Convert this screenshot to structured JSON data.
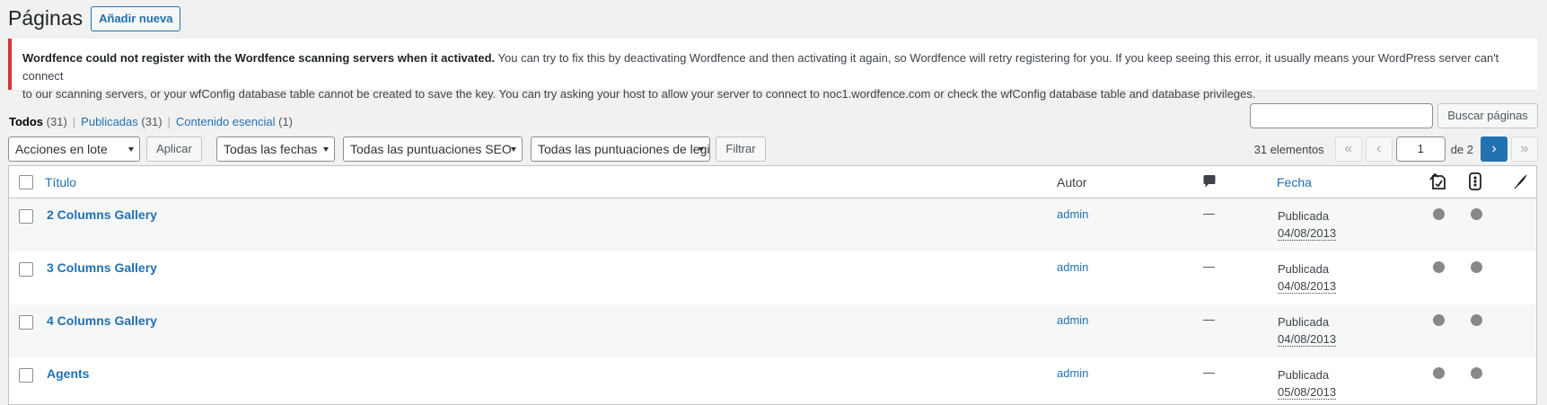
{
  "header": {
    "title": "Páginas",
    "add_new": "Añadir nueva"
  },
  "notice": {
    "bold": "Wordfence could not register with the Wordfence scanning servers when it activated.",
    "line1_rest": " You can try to fix this by deactivating Wordfence and then activating it again, so Wordfence will retry registering for you. If you keep seeing this error, it usually means your WordPress server can't connect",
    "line2": "to our scanning servers, or your wfConfig database table cannot be created to save the key. You can try asking your host to allow your server to connect to noc1.wordfence.com or check the wfConfig database table and database privileges."
  },
  "views": [
    {
      "label": "Todos",
      "count": "(31)"
    },
    {
      "label": "Publicadas",
      "count": "(31)"
    },
    {
      "label": "Contenido esencial",
      "count": "(1)"
    }
  ],
  "views_sep": "|",
  "search": {
    "value": "",
    "button": "Buscar páginas"
  },
  "tablenav": {
    "bulk_actions": "Acciones en lote",
    "apply": "Aplicar",
    "dates": "Todas las fechas",
    "seo_scores": "Todas las puntuaciones SEO",
    "readability_scores": "Todas las puntuaciones de legibilidad",
    "filter": "Filtrar"
  },
  "pagination": {
    "items": "31 elementos",
    "first": "«",
    "prev": "‹",
    "current": "1",
    "of_total": "de 2",
    "next": "›",
    "last": "»"
  },
  "columns": {
    "title": "Título",
    "author": "Autor",
    "comments_icon": "comment-bubble-icon",
    "date": "Fecha",
    "seo_icon": "seo-score-icon",
    "readability_icon": "readability-icon",
    "links_icon": "internal-links-icon"
  },
  "rows": [
    {
      "title": "2 Columns Gallery",
      "author": "admin",
      "comments": "—",
      "status": "Publicada",
      "date": "04/08/2013"
    },
    {
      "title": "3 Columns Gallery",
      "author": "admin",
      "comments": "—",
      "status": "Publicada",
      "date": "04/08/2013"
    },
    {
      "title": "4 Columns Gallery",
      "author": "admin",
      "comments": "—",
      "status": "Publicada",
      "date": "04/08/2013"
    },
    {
      "title": "Agents",
      "author": "admin",
      "comments": "—",
      "status": "Publicada",
      "date": "05/08/2013"
    }
  ],
  "colors": {
    "accent": "#2271b1",
    "notice_error": "#d63638",
    "score_dot": "#888888"
  }
}
